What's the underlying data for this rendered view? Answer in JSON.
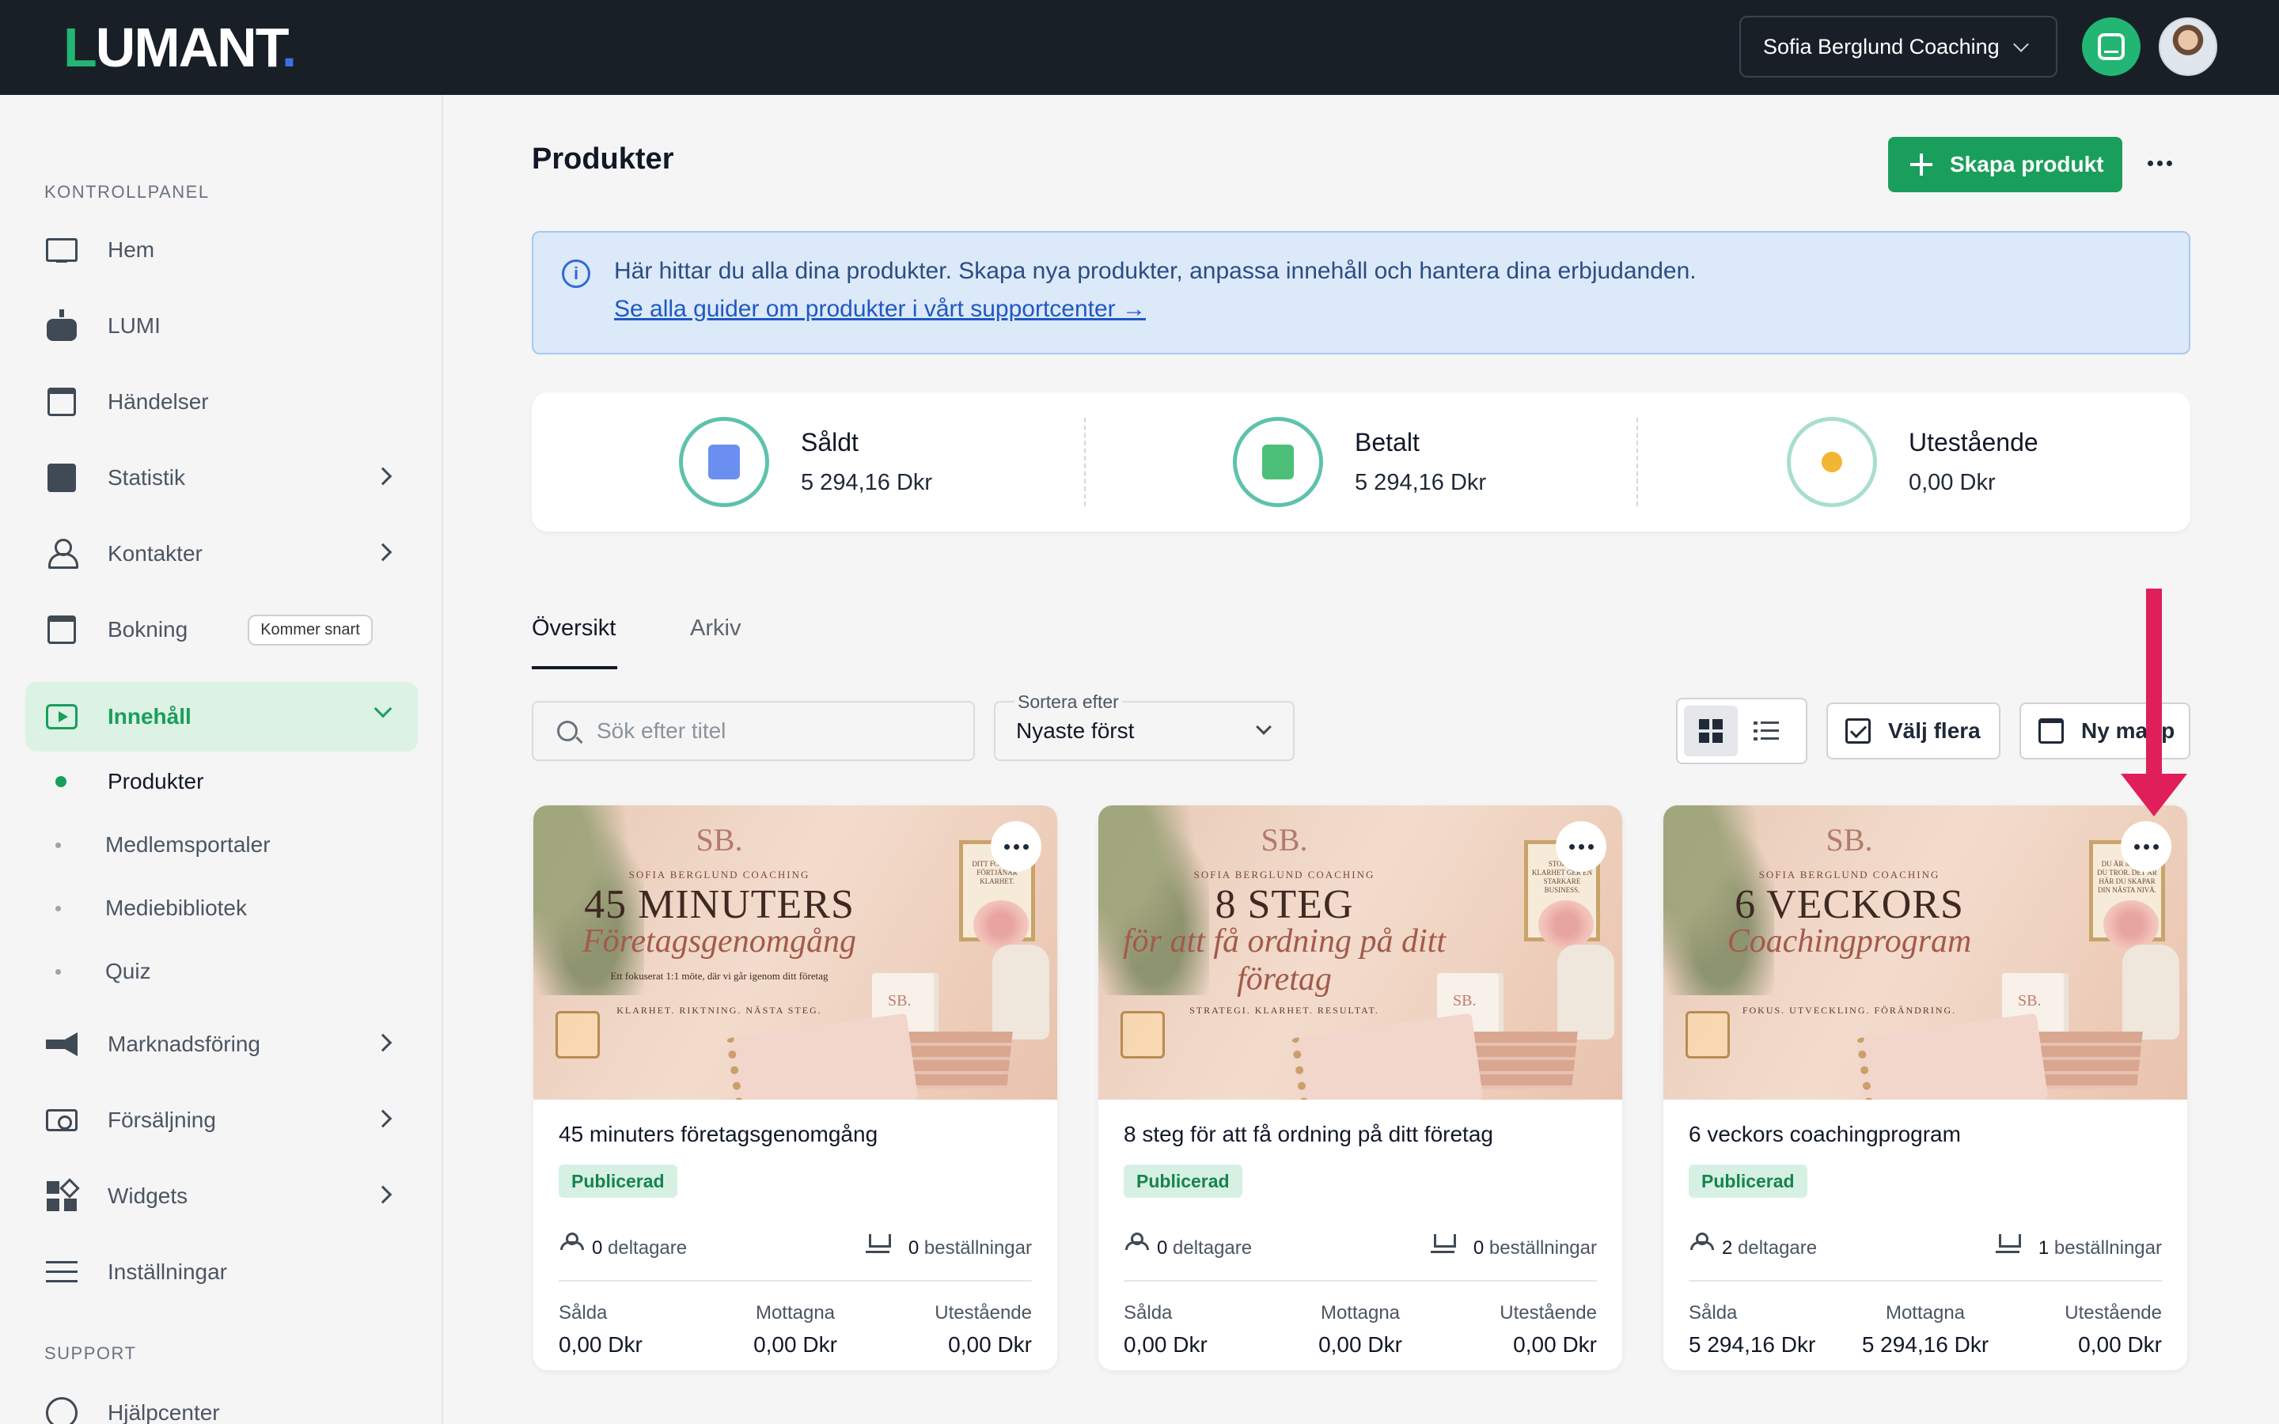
{
  "header": {
    "logo": "LUMANT",
    "account_name": "Sofia Berglund Coaching"
  },
  "sidebar": {
    "section_dashboard": "KONTROLLPANEL",
    "section_support": "SUPPORT",
    "items": [
      {
        "label": "Hem",
        "icon": "monitor-icon"
      },
      {
        "label": "LUMI",
        "icon": "robot-icon"
      },
      {
        "label": "Händelser",
        "icon": "calendar-star-icon"
      },
      {
        "label": "Statistik",
        "icon": "bar-chart-icon"
      },
      {
        "label": "Kontakter",
        "icon": "user-icon"
      },
      {
        "label": "Bokning",
        "icon": "calendar-clock-icon",
        "badge": "Kommer snart"
      },
      {
        "label": "Innehåll",
        "icon": "play-icon"
      },
      {
        "label": "Marknadsföring",
        "icon": "megaphone-icon"
      },
      {
        "label": "Försäljning",
        "icon": "cash-icon"
      },
      {
        "label": "Widgets",
        "icon": "widgets-icon"
      },
      {
        "label": "Inställningar",
        "icon": "sliders-icon"
      },
      {
        "label": "Hjälpcenter",
        "icon": "help-icon"
      }
    ],
    "content_sub": [
      "Produkter",
      "Medlemsportaler",
      "Mediebibliotek",
      "Quiz"
    ]
  },
  "page": {
    "title": "Produkter",
    "create_label": "Skapa produkt"
  },
  "info": {
    "text": "Här hittar du alla dina produkter. Skapa nya produkter, anpassa innehåll och hantera dina erbjudanden.",
    "link": "Se alla guider om produkter i vårt supportcenter →"
  },
  "stats": [
    {
      "label": "Såldt",
      "value": "5 294,16 Dkr",
      "icon": "receipt-icon",
      "color": "#6b8ff0"
    },
    {
      "label": "Betalt",
      "value": "5 294,16 Dkr",
      "icon": "paid-document-icon",
      "color": "#4cbf78"
    },
    {
      "label": "Utestående",
      "value": "0,00 Dkr",
      "icon": "pending-clock-icon",
      "color": "#f2b632"
    }
  ],
  "tabs": {
    "overview": "Översikt",
    "archive": "Arkiv"
  },
  "toolbar": {
    "search_placeholder": "Sök efter titel",
    "sort_label": "Sortera efter",
    "sort_value": "Nyaste först",
    "select_many": "Välj flera",
    "new_folder": "Ny mapp"
  },
  "labels": {
    "participants": "deltagare",
    "orders": "beställningar",
    "sold": "Sålda",
    "received": "Mottagna",
    "outstanding": "Utestående"
  },
  "products": [
    {
      "title": "45 minuters företagsgenomgång",
      "status": "Publicerad",
      "participants": "0",
      "orders": "0",
      "sold": "0,00 Dkr",
      "received": "0,00 Dkr",
      "outstanding": "0,00 Dkr",
      "image": {
        "brand": "SOFIA BERGLUND COACHING",
        "headline": "45 MINUTERS",
        "script": "Företagsgenomgång",
        "sub": "Ett fokuserat 1:1 möte, där vi går igenom ditt företag",
        "tagline": "KLARHET. RIKTNING. NÄSTA STEG.",
        "frame": "DITT FÖRETAG FÖRTJÄNAR KLARHET."
      }
    },
    {
      "title": "8 steg för att få ordning på ditt företag",
      "status": "Publicerad",
      "participants": "0",
      "orders": "0",
      "sold": "0,00 Dkr",
      "received": "0,00 Dkr",
      "outstanding": "0,00 Dkr",
      "image": {
        "brand": "SOFIA BERGLUND COACHING",
        "headline": "8 STEG",
        "script": "för att få ordning på ditt företag",
        "sub": "",
        "tagline": "STRATEGI. KLARHET. RESULTAT.",
        "frame": "STORRE KLARHET GER EN STARKARE BUSINESS."
      }
    },
    {
      "title": "6 veckors coachingprogram",
      "status": "Publicerad",
      "participants": "2",
      "orders": "1",
      "sold": "5 294,16 Dkr",
      "received": "5 294,16 Dkr",
      "outstanding": "0,00 Dkr",
      "image": {
        "brand": "SOFIA BERGLUND COACHING",
        "headline": "6 VECKORS",
        "script": "Coachingprogram",
        "sub": "",
        "tagline": "FOKUS. UTVECKLING. FÖRÄNDRING.",
        "frame": "DU ÄR MER ÄN DU TROR. DET ÄR HÄR DU SKAPAR DIN NÄSTA NIVÅ."
      }
    }
  ]
}
